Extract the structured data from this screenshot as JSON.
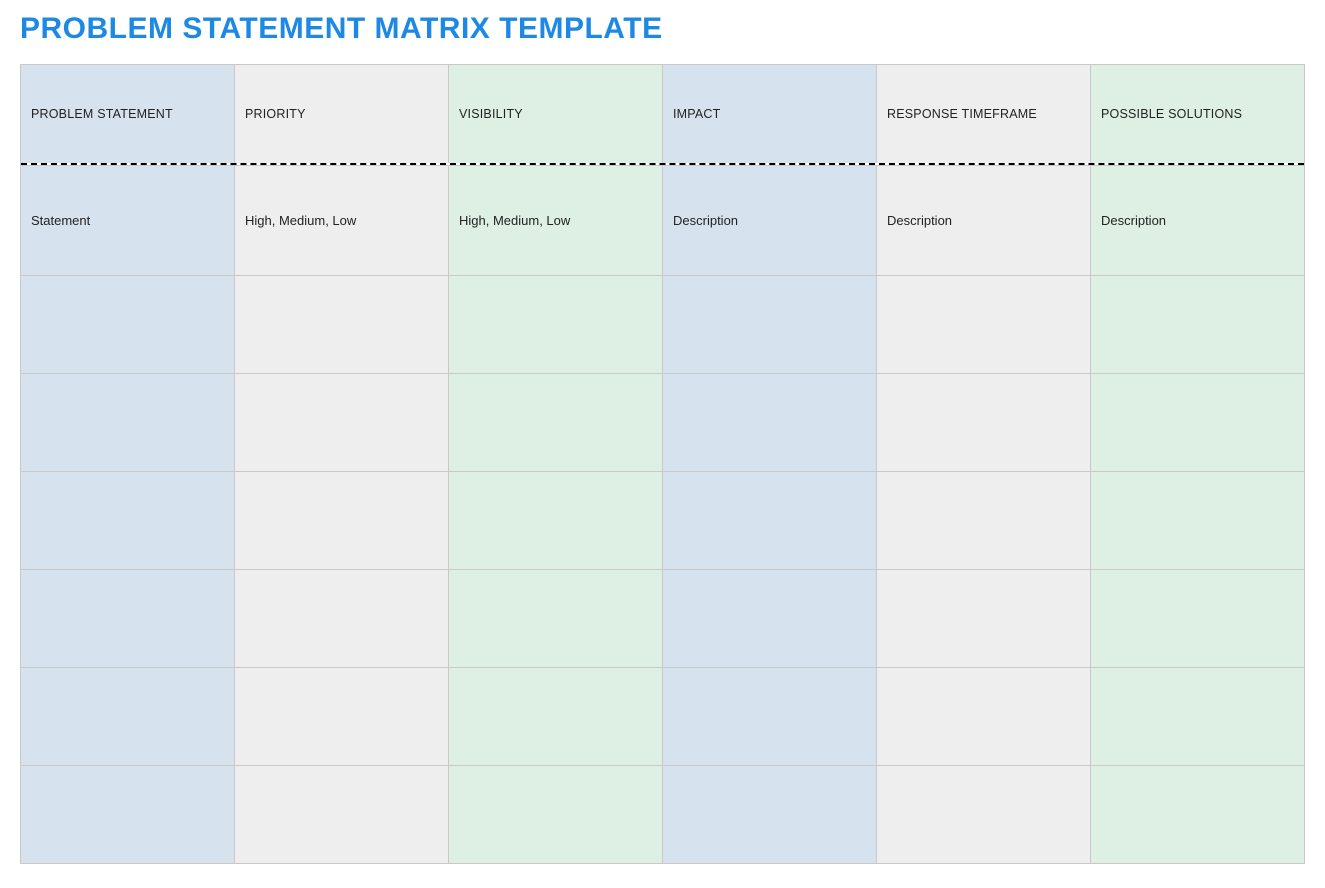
{
  "title": "PROBLEM STATEMENT MATRIX TEMPLATE",
  "columns": [
    {
      "header": "PROBLEM STATEMENT",
      "hint": "Statement"
    },
    {
      "header": "PRIORITY",
      "hint": "High, Medium, Low"
    },
    {
      "header": "VISIBILITY",
      "hint": "High, Medium, Low"
    },
    {
      "header": "IMPACT",
      "hint": "Description"
    },
    {
      "header": "RESPONSE TIMEFRAME",
      "hint": "Description"
    },
    {
      "header": "POSSIBLE SOLUTIONS",
      "hint": "Description"
    }
  ],
  "rows": [
    [
      "",
      "",
      "",
      "",
      "",
      ""
    ],
    [
      "",
      "",
      "",
      "",
      "",
      ""
    ],
    [
      "",
      "",
      "",
      "",
      "",
      ""
    ],
    [
      "",
      "",
      "",
      "",
      "",
      ""
    ],
    [
      "",
      "",
      "",
      "",
      "",
      ""
    ],
    [
      "",
      "",
      "",
      "",
      "",
      ""
    ]
  ]
}
